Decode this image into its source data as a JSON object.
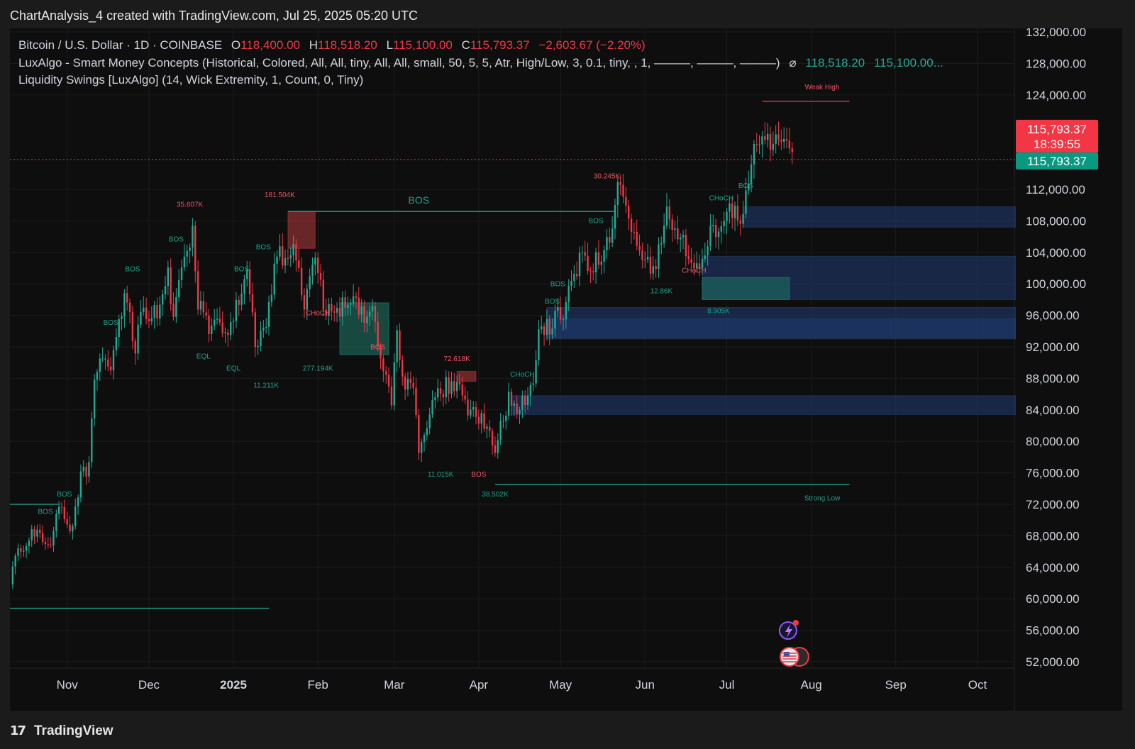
{
  "header": {
    "title": "ChartAnalysis_4 created with TradingView.com, Jul 25, 2025 05:20 UTC"
  },
  "legend": {
    "symbol": "Bitcoin / U.S. Dollar · 1D · COINBASE",
    "o_label": "O",
    "o_value": "118,400.00",
    "h_label": "H",
    "h_value": "118,518.20",
    "l_label": "L",
    "l_value": "115,100.00",
    "c_label": "C",
    "c_value": "115,793.37",
    "change": "−2,603.67 (−2.20%)",
    "indicator1": "LuxAlgo - Smart Money Concepts (Historical, Colored, All, All, tiny, All, All, small, 50, 5, 5, Atr, High/Low, 3, 0.1, tiny, , 1, ———, ———, ———)",
    "indicator1_mark": "⌀",
    "indicator1_v1": "118,518.20",
    "indicator1_v2": "115,100.00...",
    "indicator2": "Liquidity Swings [LuxAlgo] (14, Wick Extremity, 1, Count, 0, Tiny)"
  },
  "price_tags": {
    "last_price": "115,793.37",
    "countdown": "18:39:55",
    "close_price": "115,793.37"
  },
  "footer": {
    "logo_mark": "17",
    "logo_text": "TradingView"
  },
  "colors": {
    "bull": "#22ab94",
    "bear": "#f23645",
    "zone_blue": "#1e3a6e",
    "zone_green": "#1a5a50",
    "zone_red": "#8a2a2a",
    "background": "#0e0e0e"
  },
  "chart_data": {
    "type": "candlestick",
    "ylim": [
      50000,
      134000
    ],
    "y_ticks": [
      132000,
      128000,
      124000,
      112000,
      108000,
      104000,
      100000,
      96000,
      92000,
      88000,
      84000,
      80000,
      76000,
      72000,
      68000,
      64000,
      60000,
      56000,
      52000
    ],
    "y_tick_labels": [
      "132,000.00",
      "128,000.00",
      "124,000.00",
      "112,000.00",
      "108,000.00",
      "104,000.00",
      "100,000.00",
      "96,000.00",
      "92,000.00",
      "88,000.00",
      "84,000.00",
      "80,000.00",
      "76,000.00",
      "72,000.00",
      "68,000.00",
      "64,000.00",
      "60,000.00",
      "56,000.00",
      "52,000.00"
    ],
    "x_ticks": [
      {
        "date": "2024-11-01",
        "label": "Nov",
        "bold": false
      },
      {
        "date": "2024-12-01",
        "label": "Dec",
        "bold": false
      },
      {
        "date": "2025-01-01",
        "label": "2025",
        "bold": true
      },
      {
        "date": "2025-02-01",
        "label": "Feb",
        "bold": false
      },
      {
        "date": "2025-03-01",
        "label": "Mar",
        "bold": false
      },
      {
        "date": "2025-04-01",
        "label": "Apr",
        "bold": false
      },
      {
        "date": "2025-05-01",
        "label": "May",
        "bold": false
      },
      {
        "date": "2025-06-01",
        "label": "Jun",
        "bold": false
      },
      {
        "date": "2025-07-01",
        "label": "Jul",
        "bold": false
      },
      {
        "date": "2025-08-01",
        "label": "Aug",
        "bold": false
      },
      {
        "date": "2025-09-01",
        "label": "Sep",
        "bold": false
      },
      {
        "date": "2025-10-01",
        "label": "Oct",
        "bold": false
      }
    ],
    "close_series": [
      [
        "2024-10-11",
        62500
      ],
      [
        "2024-10-14",
        66000
      ],
      [
        "2024-10-17",
        67500
      ],
      [
        "2024-10-20",
        68800
      ],
      [
        "2024-10-23",
        66800
      ],
      [
        "2024-10-26",
        67200
      ],
      [
        "2024-10-29",
        72500
      ],
      [
        "2024-10-31",
        70200
      ],
      [
        "2024-11-03",
        68500
      ],
      [
        "2024-11-06",
        75500
      ],
      [
        "2024-11-09",
        76500
      ],
      [
        "2024-11-11",
        88500
      ],
      [
        "2024-11-13",
        90500
      ],
      [
        "2024-11-17",
        90000
      ],
      [
        "2024-11-20",
        94500
      ],
      [
        "2024-11-22",
        99200
      ],
      [
        "2024-11-26",
        91900
      ],
      [
        "2024-11-29",
        97400
      ],
      [
        "2024-12-02",
        95800
      ],
      [
        "2024-12-05",
        97000
      ],
      [
        "2024-12-08",
        101000
      ],
      [
        "2024-12-10",
        96500
      ],
      [
        "2024-12-13",
        101000
      ],
      [
        "2024-12-17",
        106000
      ],
      [
        "2024-12-19",
        97500
      ],
      [
        "2024-12-21",
        97000
      ],
      [
        "2024-12-23",
        94500
      ],
      [
        "2024-12-26",
        95800
      ],
      [
        "2024-12-30",
        92500
      ],
      [
        "2025-01-02",
        97000
      ],
      [
        "2025-01-06",
        102000
      ],
      [
        "2025-01-09",
        92500
      ],
      [
        "2025-01-13",
        94500
      ],
      [
        "2025-01-17",
        104500
      ],
      [
        "2025-01-20",
        102000
      ],
      [
        "2025-01-23",
        104000
      ],
      [
        "2025-01-27",
        98000
      ],
      [
        "2025-01-31",
        102400
      ],
      [
        "2025-02-03",
        97500
      ],
      [
        "2025-02-06",
        96500
      ],
      [
        "2025-02-10",
        97400
      ],
      [
        "2025-02-14",
        97500
      ],
      [
        "2025-02-18",
        95500
      ],
      [
        "2025-02-21",
        96100
      ],
      [
        "2025-02-25",
        88700
      ],
      [
        "2025-02-28",
        84300
      ],
      [
        "2025-03-02",
        94200
      ],
      [
        "2025-03-04",
        87300
      ],
      [
        "2025-03-08",
        86700
      ],
      [
        "2025-03-10",
        78600
      ],
      [
        "2025-03-14",
        84000
      ],
      [
        "2025-03-19",
        86800
      ],
      [
        "2025-03-24",
        87500
      ],
      [
        "2025-03-28",
        84300
      ],
      [
        "2025-04-02",
        82500
      ],
      [
        "2025-04-07",
        79200
      ],
      [
        "2025-04-09",
        82600
      ],
      [
        "2025-04-12",
        85200
      ],
      [
        "2025-04-16",
        84000
      ],
      [
        "2025-04-21",
        87500
      ],
      [
        "2025-04-23",
        93700
      ],
      [
        "2025-04-28",
        95000
      ],
      [
        "2025-05-02",
        96500
      ],
      [
        "2025-05-08",
        103000
      ],
      [
        "2025-05-12",
        102800
      ],
      [
        "2025-05-17",
        103200
      ],
      [
        "2025-05-22",
        111600
      ],
      [
        "2025-05-26",
        109400
      ],
      [
        "2025-05-30",
        104000
      ],
      [
        "2025-06-05",
        101500
      ],
      [
        "2025-06-09",
        110200
      ],
      [
        "2025-06-13",
        105900
      ],
      [
        "2025-06-17",
        104500
      ],
      [
        "2025-06-21",
        102200
      ],
      [
        "2025-06-24",
        105900
      ],
      [
        "2025-06-28",
        107300
      ],
      [
        "2025-07-02",
        108800
      ],
      [
        "2025-07-07",
        108200
      ],
      [
        "2025-07-10",
        116000
      ],
      [
        "2025-07-14",
        119800
      ],
      [
        "2025-07-16",
        118600
      ],
      [
        "2025-07-20",
        117300
      ],
      [
        "2025-07-22",
        119900
      ],
      [
        "2025-07-24",
        118400
      ],
      [
        "2025-07-25",
        115793
      ]
    ],
    "zones": [
      {
        "kind": "order-block",
        "color": "blue",
        "from": "2025-07-07",
        "to": "2025-10-15",
        "low": 107200,
        "high": 109800
      },
      {
        "kind": "order-block",
        "color": "blue",
        "from": "2025-06-22",
        "to": "2025-10-15",
        "low": 98000,
        "high": 103500
      },
      {
        "kind": "order-block",
        "color": "blue",
        "from": "2025-04-26",
        "to": "2025-10-15",
        "low": 93000,
        "high": 97000
      },
      {
        "kind": "order-block",
        "color": "blue",
        "from": "2025-04-26",
        "to": "2025-10-15",
        "low": 93200,
        "high": 95600
      },
      {
        "kind": "order-block",
        "color": "blue",
        "from": "2025-04-13",
        "to": "2025-10-15",
        "low": 83400,
        "high": 85800
      },
      {
        "kind": "order-block",
        "color": "green",
        "from": "2025-06-22",
        "to": "2025-07-24",
        "low": 98000,
        "high": 100800
      },
      {
        "kind": "order-block",
        "color": "green",
        "from": "2025-02-09",
        "to": "2025-02-27",
        "low": 91000,
        "high": 97600
      },
      {
        "kind": "order-block",
        "color": "red",
        "from": "2025-01-21",
        "to": "2025-01-31",
        "low": 104500,
        "high": 109200
      },
      {
        "kind": "order-block",
        "color": "red",
        "from": "2025-03-24",
        "to": "2025-03-31",
        "low": 87600,
        "high": 88900
      }
    ],
    "levels": [
      {
        "label": "Weak High",
        "color": "red",
        "from": "2025-07-14",
        "to": "2025-08-15",
        "price": 123200
      },
      {
        "label": "Strong Low",
        "color": "teal",
        "from": "2025-04-07",
        "to": "2025-08-15",
        "price": 74500
      },
      {
        "label": "",
        "color": "teal",
        "from": "2024-10-11",
        "to": "2025-01-14",
        "price": 58800
      },
      {
        "label": "",
        "color": "teal",
        "from": "2025-01-21",
        "to": "2025-05-21",
        "price": 109200
      },
      {
        "label": "",
        "color": "teal",
        "from": "2024-10-11",
        "to": "2024-10-29",
        "price": 72000
      }
    ],
    "annotations": [
      {
        "text": "Weak High",
        "date": "2025-08-05",
        "price": 124700,
        "color": "red"
      },
      {
        "text": "Strong Low",
        "date": "2025-08-05",
        "price": 72500,
        "color": "teal"
      },
      {
        "text": "BOS",
        "date": "2025-03-10",
        "price": 110200,
        "color": "teal",
        "size": "large"
      },
      {
        "text": "35.607K",
        "date": "2024-12-16",
        "price": 109800,
        "color": "red"
      },
      {
        "text": "181.504K",
        "date": "2025-01-18",
        "price": 111000,
        "color": "red"
      },
      {
        "text": "30.245K",
        "date": "2025-05-18",
        "price": 113400,
        "color": "red"
      },
      {
        "text": "72.618K",
        "date": "2025-03-24",
        "price": 90200,
        "color": "red"
      },
      {
        "text": "BOS",
        "date": "2024-12-11",
        "price": 105400,
        "color": "teal"
      },
      {
        "text": "BOS",
        "date": "2024-11-25",
        "price": 101600,
        "color": "teal"
      },
      {
        "text": "BOS",
        "date": "2024-11-17",
        "price": 94800,
        "color": "teal"
      },
      {
        "text": "BOS",
        "date": "2024-10-31",
        "price": 73000,
        "color": "teal"
      },
      {
        "text": "BOS",
        "date": "2024-10-24",
        "price": 70800,
        "color": "teal"
      },
      {
        "text": "BOS",
        "date": "2025-01-04",
        "price": 101600,
        "color": "teal"
      },
      {
        "text": "BOS",
        "date": "2025-01-12",
        "price": 104400,
        "color": "teal"
      },
      {
        "text": "CHoCH",
        "date": "2025-02-01",
        "price": 96000,
        "color": "red"
      },
      {
        "text": "BOS",
        "date": "2025-02-23",
        "price": 91700,
        "color": "red"
      },
      {
        "text": "CHoCH",
        "date": "2025-04-17",
        "price": 88200,
        "color": "teal"
      },
      {
        "text": "BOS",
        "date": "2025-04-28",
        "price": 97500,
        "color": "teal"
      },
      {
        "text": "BOS",
        "date": "2025-04-30",
        "price": 99700,
        "color": "teal"
      },
      {
        "text": "BOS",
        "date": "2025-05-14",
        "price": 107700,
        "color": "teal"
      },
      {
        "text": "CHoCH",
        "date": "2025-06-29",
        "price": 110600,
        "color": "teal"
      },
      {
        "text": "BOS",
        "date": "2025-07-08",
        "price": 112200,
        "color": "teal"
      },
      {
        "text": "CHoCH",
        "date": "2025-06-19",
        "price": 101400,
        "color": "red"
      },
      {
        "text": "BOS",
        "date": "2025-04-01",
        "price": 75500,
        "color": "red"
      },
      {
        "text": "EQL",
        "date": "2024-12-21",
        "price": 90500,
        "color": "teal"
      },
      {
        "text": "EQL",
        "date": "2025-01-01",
        "price": 89000,
        "color": "teal"
      },
      {
        "text": "277.194K",
        "date": "2025-02-01",
        "price": 89000,
        "color": "teal"
      },
      {
        "text": "11.211K",
        "date": "2025-01-13",
        "price": 86800,
        "color": "teal"
      },
      {
        "text": "11.015K",
        "date": "2025-03-18",
        "price": 75500,
        "color": "teal"
      },
      {
        "text": "38.502K",
        "date": "2025-04-07",
        "price": 73000,
        "color": "teal"
      },
      {
        "text": "12.86K",
        "date": "2025-06-07",
        "price": 98800,
        "color": "teal"
      },
      {
        "text": "8.905K",
        "date": "2025-06-28",
        "price": 96300,
        "color": "teal"
      }
    ],
    "grid": true,
    "legend_position": "top-left"
  }
}
